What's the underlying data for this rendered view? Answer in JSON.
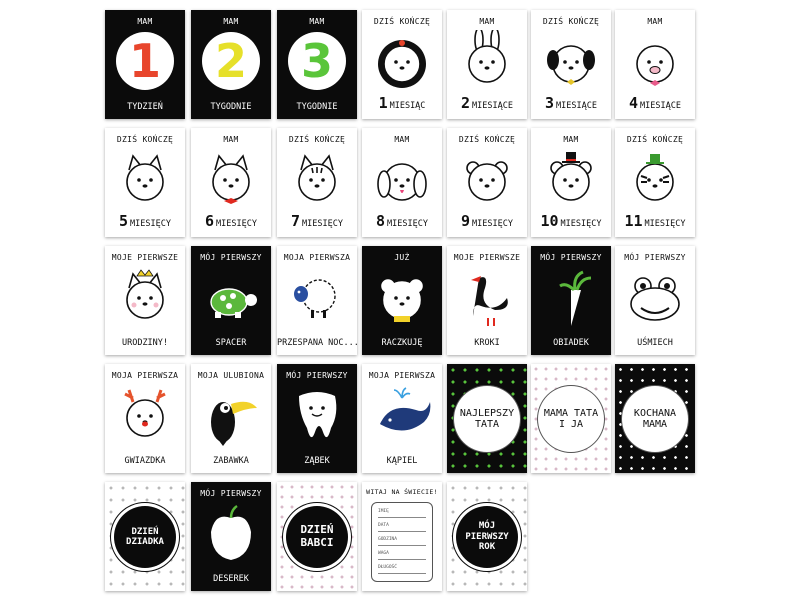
{
  "cards": [
    {
      "top": "MAM",
      "num": "1",
      "numColor": "#e8452c",
      "bottom": "TYDZIEŃ",
      "theme": "dark"
    },
    {
      "top": "MAM",
      "num": "2",
      "numColor": "#e6e02a",
      "bottom": "TYGODNIE",
      "theme": "dark"
    },
    {
      "top": "MAM",
      "num": "3",
      "numColor": "#5ac53a",
      "bottom": "TYGODNIE",
      "theme": "dark"
    },
    {
      "top": "DZIŚ KOŃCZĘ",
      "big": "1",
      "bottom": "MIESIĄC",
      "icon": "lion-icon",
      "theme": "light"
    },
    {
      "top": "MAM",
      "big": "2",
      "bottom": "MIESIĄCE",
      "icon": "bunny-icon",
      "theme": "light"
    },
    {
      "top": "DZIŚ KOŃCZĘ",
      "big": "3",
      "bottom": "MIESIĄCE",
      "icon": "dog-icon",
      "theme": "light"
    },
    {
      "top": "MAM",
      "big": "4",
      "bottom": "MIESIĄCE",
      "icon": "pig-icon",
      "theme": "light"
    },
    {
      "top": "DZIŚ KOŃCZĘ",
      "big": "5",
      "bottom": "MIESIĘCY",
      "icon": "cat-icon",
      "theme": "light"
    },
    {
      "top": "MAM",
      "big": "6",
      "bottom": "MIESIĘCY",
      "icon": "cat-bowtie-icon",
      "theme": "light"
    },
    {
      "top": "DZIŚ KOŃCZĘ",
      "big": "7",
      "bottom": "MIESIĘCY",
      "icon": "striped-cat-icon",
      "theme": "light"
    },
    {
      "top": "MAM",
      "big": "8",
      "bottom": "MIESIĘCY",
      "icon": "puppy-icon",
      "theme": "light"
    },
    {
      "top": "DZIŚ KOŃCZĘ",
      "big": "9",
      "bottom": "MIESIĘCY",
      "icon": "bear-icon",
      "theme": "light"
    },
    {
      "top": "MAM",
      "big": "10",
      "bottom": "MIESIĘCY",
      "icon": "bear-hat-icon",
      "theme": "light"
    },
    {
      "top": "DZIŚ KOŃCZĘ",
      "big": "11",
      "bottom": "MIESIĘCY",
      "icon": "tiger-icon",
      "theme": "light"
    },
    {
      "top": "MOJE PIERWSZE",
      "bottom": "URODZINY!",
      "icon": "crown-cat-icon",
      "theme": "light"
    },
    {
      "top": "MÓJ PIERWSZY",
      "bottom": "SPACER",
      "icon": "turtle-icon",
      "theme": "dark"
    },
    {
      "top": "MOJA PIERWSZA",
      "bottom": "PRZESPANA NOC...",
      "icon": "sheep-icon",
      "theme": "light"
    },
    {
      "top": "JUŻ",
      "bottom": "RACZKUJĘ",
      "icon": "polar-bear-icon",
      "theme": "dark"
    },
    {
      "top": "MOJE PIERWSZE",
      "bottom": "KROKI",
      "icon": "swan-icon",
      "theme": "light"
    },
    {
      "top": "MÓJ PIERWSZY",
      "bottom": "OBIADEK",
      "icon": "carrot-icon",
      "theme": "dark"
    },
    {
      "top": "MÓJ PIERWSZY",
      "bottom": "UŚMIECH",
      "icon": "frog-icon",
      "theme": "light"
    },
    {
      "top": "MOJA PIERWSZA",
      "bottom": "GWIAZDKA",
      "icon": "reindeer-icon",
      "theme": "light"
    },
    {
      "top": "MOJA ULUBIONA",
      "bottom": "ZABAWKA",
      "icon": "toucan-icon",
      "theme": "light"
    },
    {
      "top": "MÓJ PIERWSZY",
      "bottom": "ZĄBEK",
      "icon": "tooth-icon",
      "theme": "dark"
    },
    {
      "top": "MOJA PIERWSZA",
      "bottom": "KĄPIEL",
      "icon": "whale-icon",
      "theme": "light"
    },
    {
      "badge": "NAJLEPSZY TATA",
      "style": "dots-green"
    },
    {
      "badge": "MAMA TATA I JA",
      "style": "pattern-light"
    },
    {
      "badge": "KOCHANA MAMA",
      "style": "dots-black"
    },
    {
      "badge": "DZIEŃ DZIADKA",
      "style": "pattern-gray",
      "badgeDark": true
    },
    {
      "top": "MÓJ PIERWSZY",
      "bottom": "DESEREK",
      "icon": "apple-icon",
      "theme": "dark"
    },
    {
      "badge": "DZIEŃ BABCI",
      "style": "pattern-light",
      "badgeDark": true
    },
    {
      "top": "WITAJ NA ŚWIECIE!",
      "form": [
        "IMIĘ",
        "DATA",
        "GODZINA",
        "WAGA",
        "DŁUGOŚĆ"
      ],
      "theme": "light"
    },
    {
      "badge": "MÓJ PIERWSZY ROK",
      "style": "pattern-gray",
      "badgeDark": true
    }
  ]
}
